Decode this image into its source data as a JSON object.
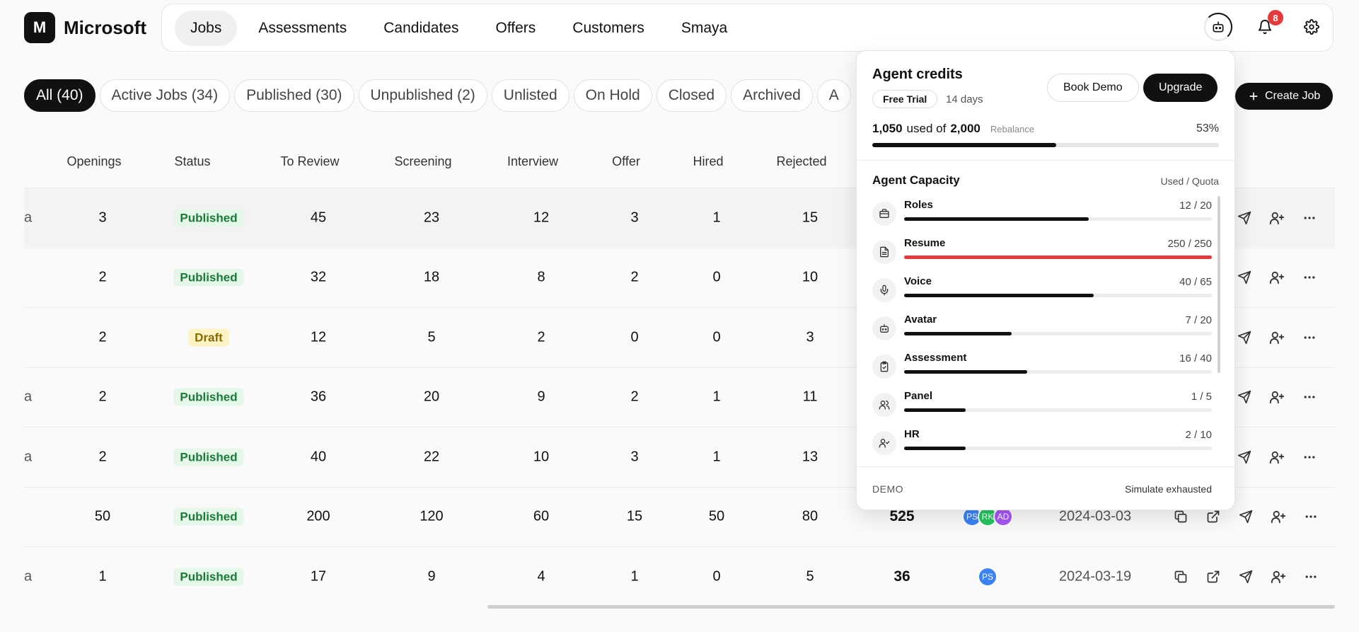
{
  "brand": {
    "logo_letter": "M",
    "name": "Microsoft"
  },
  "nav": {
    "tabs": [
      {
        "label": "Jobs",
        "active": true
      },
      {
        "label": "Assessments"
      },
      {
        "label": "Candidates"
      },
      {
        "label": "Offers"
      },
      {
        "label": "Customers"
      },
      {
        "label": "Smaya"
      }
    ],
    "notifications_count": "8",
    "icons": [
      "agent-icon",
      "bell-icon",
      "gear-icon"
    ]
  },
  "filters": [
    {
      "label": "All (40)",
      "active": true
    },
    {
      "label": "Active Jobs (34)"
    },
    {
      "label": "Published (30)"
    },
    {
      "label": "Unpublished (2)"
    },
    {
      "label": "Unlisted"
    },
    {
      "label": "On Hold"
    },
    {
      "label": "Closed"
    },
    {
      "label": "Archived"
    },
    {
      "label": "A"
    }
  ],
  "create_job_label": "Create Job",
  "table": {
    "headers": [
      "Openings",
      "Status",
      "To Review",
      "Screening",
      "Interview",
      "Offer",
      "Hired",
      "Rejected"
    ],
    "rows": [
      {
        "edge": "a",
        "openings": "3",
        "status": "Published",
        "to_review": "45",
        "screening": "23",
        "interview": "12",
        "offer": "3",
        "hired": "1",
        "rejected": "15"
      },
      {
        "edge": "",
        "openings": "2",
        "status": "Published",
        "to_review": "32",
        "screening": "18",
        "interview": "8",
        "offer": "2",
        "hired": "0",
        "rejected": "10"
      },
      {
        "edge": "",
        "openings": "2",
        "status": "Draft",
        "to_review": "12",
        "screening": "5",
        "interview": "2",
        "offer": "0",
        "hired": "0",
        "rejected": "3"
      },
      {
        "edge": "a",
        "openings": "2",
        "status": "Published",
        "to_review": "36",
        "screening": "20",
        "interview": "9",
        "offer": "2",
        "hired": "1",
        "rejected": "11"
      },
      {
        "edge": "a",
        "openings": "2",
        "status": "Published",
        "to_review": "40",
        "screening": "22",
        "interview": "10",
        "offer": "3",
        "hired": "1",
        "rejected": "13"
      },
      {
        "edge": "",
        "openings": "50",
        "status": "Published",
        "to_review": "200",
        "screening": "120",
        "interview": "60",
        "offer": "15",
        "hired": "50",
        "rejected": "80",
        "total": "525",
        "team": [
          {
            "initials": "PS",
            "color": "#3b82f6"
          },
          {
            "initials": "RK",
            "color": "#22c55e"
          },
          {
            "initials": "AD",
            "color": "#a855f7"
          }
        ],
        "date": "2024-03-03"
      },
      {
        "edge": "a",
        "openings": "1",
        "status": "Published",
        "to_review": "17",
        "screening": "9",
        "interview": "4",
        "offer": "1",
        "hired": "0",
        "rejected": "5",
        "total": "36",
        "team": [
          {
            "initials": "PS",
            "color": "#3b82f6"
          }
        ],
        "date": "2024-03-19"
      }
    ]
  },
  "credits": {
    "title": "Agent credits",
    "plan": "Free Trial",
    "days_left": "14 days",
    "book_demo": "Book Demo",
    "upgrade": "Upgrade",
    "used": "1,050",
    "used_word": "used of",
    "total": "2,000",
    "rebalance": "Rebalance",
    "percent": "53%",
    "fraction": 0.53,
    "capacity_title": "Agent Capacity",
    "capacity_sub": "Used / Quota",
    "items": [
      {
        "name": "Roles",
        "value": "12 / 20",
        "fraction": 0.6,
        "icon": "briefcase-icon"
      },
      {
        "name": "Resume",
        "value": "250 / 250",
        "fraction": 1.0,
        "icon": "document-icon",
        "full": true
      },
      {
        "name": "Voice",
        "value": "40 / 65",
        "fraction": 0.615,
        "icon": "microphone-icon"
      },
      {
        "name": "Avatar",
        "value": "7 / 20",
        "fraction": 0.35,
        "icon": "robot-icon"
      },
      {
        "name": "Assessment",
        "value": "16 / 40",
        "fraction": 0.4,
        "icon": "clipboard-check-icon"
      },
      {
        "name": "Panel",
        "value": "1 / 5",
        "fraction": 0.2,
        "icon": "users-icon"
      },
      {
        "name": "HR",
        "value": "2 / 10",
        "fraction": 0.2,
        "icon": "user-check-icon"
      }
    ],
    "demo_label": "DEMO",
    "simulate": "Simulate exhausted"
  }
}
